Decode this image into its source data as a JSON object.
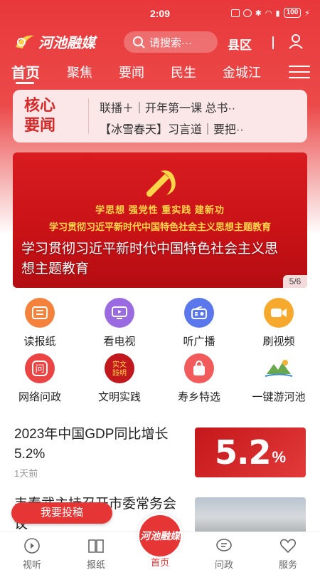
{
  "status_bar": {
    "time": "2:09",
    "battery": "100"
  },
  "header": {
    "logo_text": "河池融媒",
    "search_placeholder": "请搜索···",
    "county_label": "县区"
  },
  "tabs": [
    "首页",
    "聚焦",
    "要闻",
    "民生",
    "金城江"
  ],
  "core_news": {
    "label_line1": "核心",
    "label_line2": "要闻",
    "items": [
      "联播＋｜开年第一课 总书··",
      "【冰雪春天】习言道｜要把··"
    ]
  },
  "banner": {
    "slogan": "学思想  强党性  重实践  建新功",
    "subtitle": "学习贯彻习近平新时代中国特色社会主义思想主题教育",
    "caption": "学习贯彻习近平新时代中国特色社会主义思想主题教育",
    "counter": "5/6"
  },
  "features": [
    {
      "label": "读报纸",
      "icon": "newspaper-icon",
      "color": "#f4823c"
    },
    {
      "label": "看电视",
      "icon": "tv-icon",
      "color": "#9a6ae0"
    },
    {
      "label": "听广播",
      "icon": "radio-icon",
      "color": "#5a78ec"
    },
    {
      "label": "刷视频",
      "icon": "video-camera-icon",
      "color": "#f7a92e"
    },
    {
      "label": "网络问政",
      "icon": "ask-icon",
      "color": "#ea4444"
    },
    {
      "label": "文明实践",
      "icon": "civilization-practice-icon",
      "color": "#c0181c"
    },
    {
      "label": "寿乡特选",
      "icon": "shopping-bag-icon",
      "color": "#f25b5b"
    },
    {
      "label": "一键游河池",
      "icon": "travel-hechi-icon",
      "color": "#6aa84f"
    }
  ],
  "articles": [
    {
      "title": "2023年中国GDP同比增长5.2%",
      "time": "1天前",
      "thumb_value": "5.2",
      "thumb_unit": "%"
    },
    {
      "title": "韦春武主持召开市委常务会议"
    }
  ],
  "submit_button": "我要投稿",
  "bottom_nav": [
    {
      "label": "视听",
      "icon": "play-icon"
    },
    {
      "label": "报纸",
      "icon": "book-icon"
    },
    {
      "label": "首页",
      "icon": "home-logo-icon"
    },
    {
      "label": "问政",
      "icon": "message-icon"
    },
    {
      "label": "服务",
      "icon": "heart-icon"
    }
  ],
  "colors": {
    "brand_red": "#e53535",
    "banner_gold": "#ffd54a"
  }
}
